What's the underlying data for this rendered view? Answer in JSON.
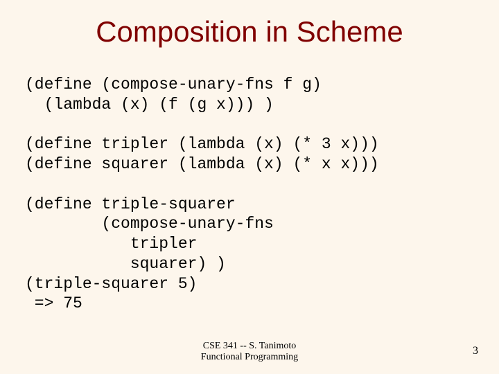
{
  "title": "Composition in Scheme",
  "code": {
    "lines": [
      "(define (compose-unary-fns f g)",
      "  (lambda (x) (f (g x))) )",
      "",
      "(define tripler (lambda (x) (* 3 x)))",
      "(define squarer (lambda (x) (* x x)))",
      "",
      "(define triple-squarer",
      "        (compose-unary-fns",
      "           tripler",
      "           squarer) )",
      "(triple-squarer 5)",
      " => 75"
    ]
  },
  "footer": {
    "line1": "CSE 341 -- S. Tanimoto",
    "line2": "Functional Programming"
  },
  "page_number": "3"
}
